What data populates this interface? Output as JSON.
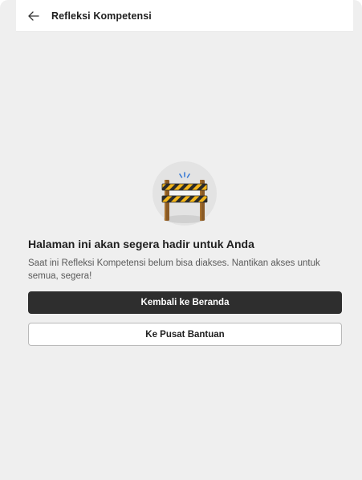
{
  "header": {
    "back_icon": "arrow-left-icon",
    "title": "Refleksi Kompetensi"
  },
  "illustration": {
    "icon": "roadblock-barrier-icon"
  },
  "content": {
    "heading": "Halaman ini akan segera hadir untuk Anda",
    "description": "Saat ini Refleksi Kompetensi belum bisa diakses. Nantikan akses untuk semua, segera!"
  },
  "actions": {
    "primary_label": "Kembali ke Beranda",
    "secondary_label": "Ke Pusat Bantuan"
  },
  "colors": {
    "background": "#efefef",
    "primary_button": "#2e2e2e",
    "barrier_yellow": "#f2b51a",
    "barrier_wood": "#8a5a25"
  }
}
